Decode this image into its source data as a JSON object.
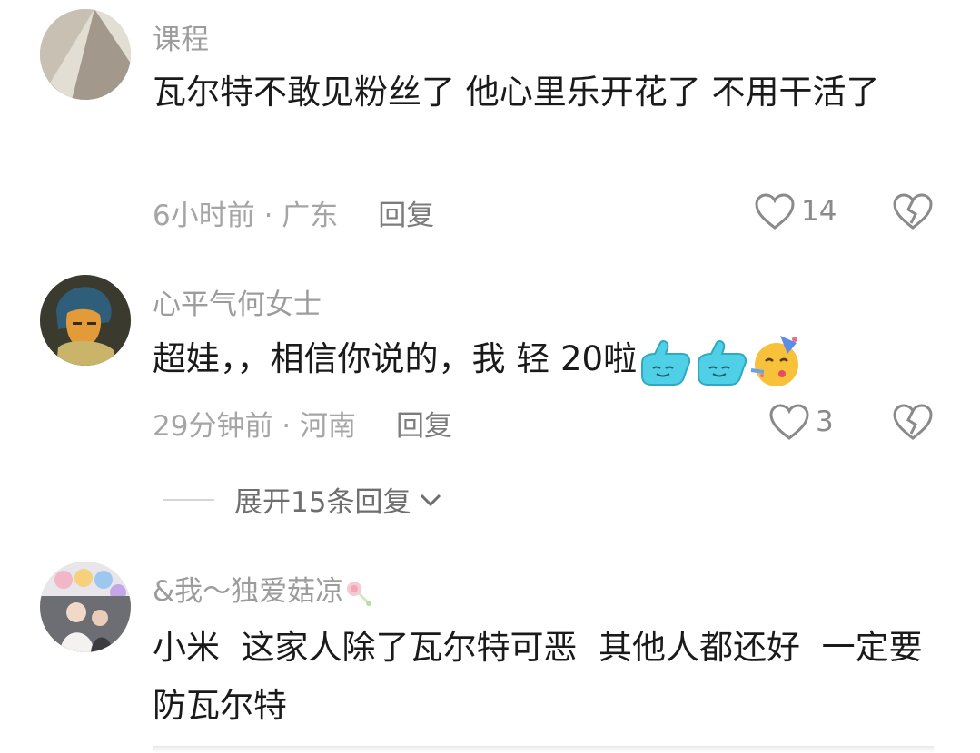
{
  "comments": [
    {
      "username": "课程",
      "content": "瓦尔特不敢见粉丝了 他心里乐开花了 不用干活了",
      "time": "6小时前",
      "location": "广东",
      "reply_label": "回复",
      "likes": "14"
    },
    {
      "username": "心平气何女士",
      "content": "超娃，，相信你说的，我 轻 20啦",
      "emojis": [
        "blue-thumb-emoji",
        "blue-thumb-emoji",
        "party-face-emoji"
      ],
      "time": "29分钟前",
      "location": "河南",
      "reply_label": "回复",
      "likes": "3"
    },
    {
      "username": "&我～独爱菇凉",
      "username_emoji": "lollipop-emoji",
      "content": "小米  这家人除了瓦尔特可恶  其他人都还好  一定要防瓦尔特"
    }
  ],
  "expand_replies": "展开15条回复",
  "separator": " · ",
  "colors": {
    "text": "#1a1a1a",
    "meta": "#a5a5a5",
    "accent_blue": "#49c8e0"
  }
}
